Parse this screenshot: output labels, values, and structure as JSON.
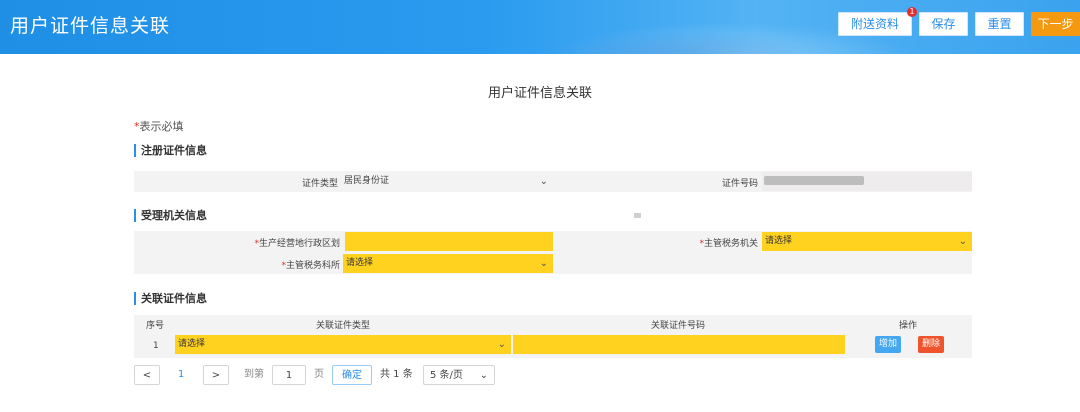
{
  "header": {
    "title": "用户证件信息关联",
    "buttons": {
      "attach": "附送资料",
      "save": "保存",
      "reset": "重置",
      "next": "下一步"
    },
    "attach_badge": "1"
  },
  "page_title": "用户证件信息关联",
  "required_note": {
    "star": "*",
    "text": "表示必填"
  },
  "registration": {
    "section_title": "注册证件信息",
    "cert_type_label": "证件类型",
    "cert_type_value": "居民身份证",
    "cert_no_label": "证件号码"
  },
  "authority": {
    "section_title": "受理机关信息",
    "region_label": "生产经营地行政区划",
    "tax_office_label": "主管税务机关",
    "tax_office_value": "请选择",
    "tax_branch_label": "主管税务科所",
    "tax_branch_value": "请选择"
  },
  "related": {
    "section_title": "关联证件信息",
    "columns": {
      "seq": "序号",
      "type": "关联证件类型",
      "number": "关联证件号码",
      "action": "操作"
    },
    "rows": [
      {
        "seq": "1",
        "type": "请选择",
        "number": ""
      }
    ],
    "add_label": "增加",
    "delete_label": "删除"
  },
  "pagination": {
    "prev": "<",
    "current_page": "1",
    "next": ">",
    "goto_label": "到第",
    "goto_value": "1",
    "page_unit": "页",
    "confirm": "确定",
    "total": "共 1 条",
    "page_size": "5 条/页"
  },
  "colors": {
    "accent": "#2b8ee8",
    "required_fill": "#ffd21f",
    "next_button": "#f59a10",
    "delete_button": "#f0542d"
  }
}
